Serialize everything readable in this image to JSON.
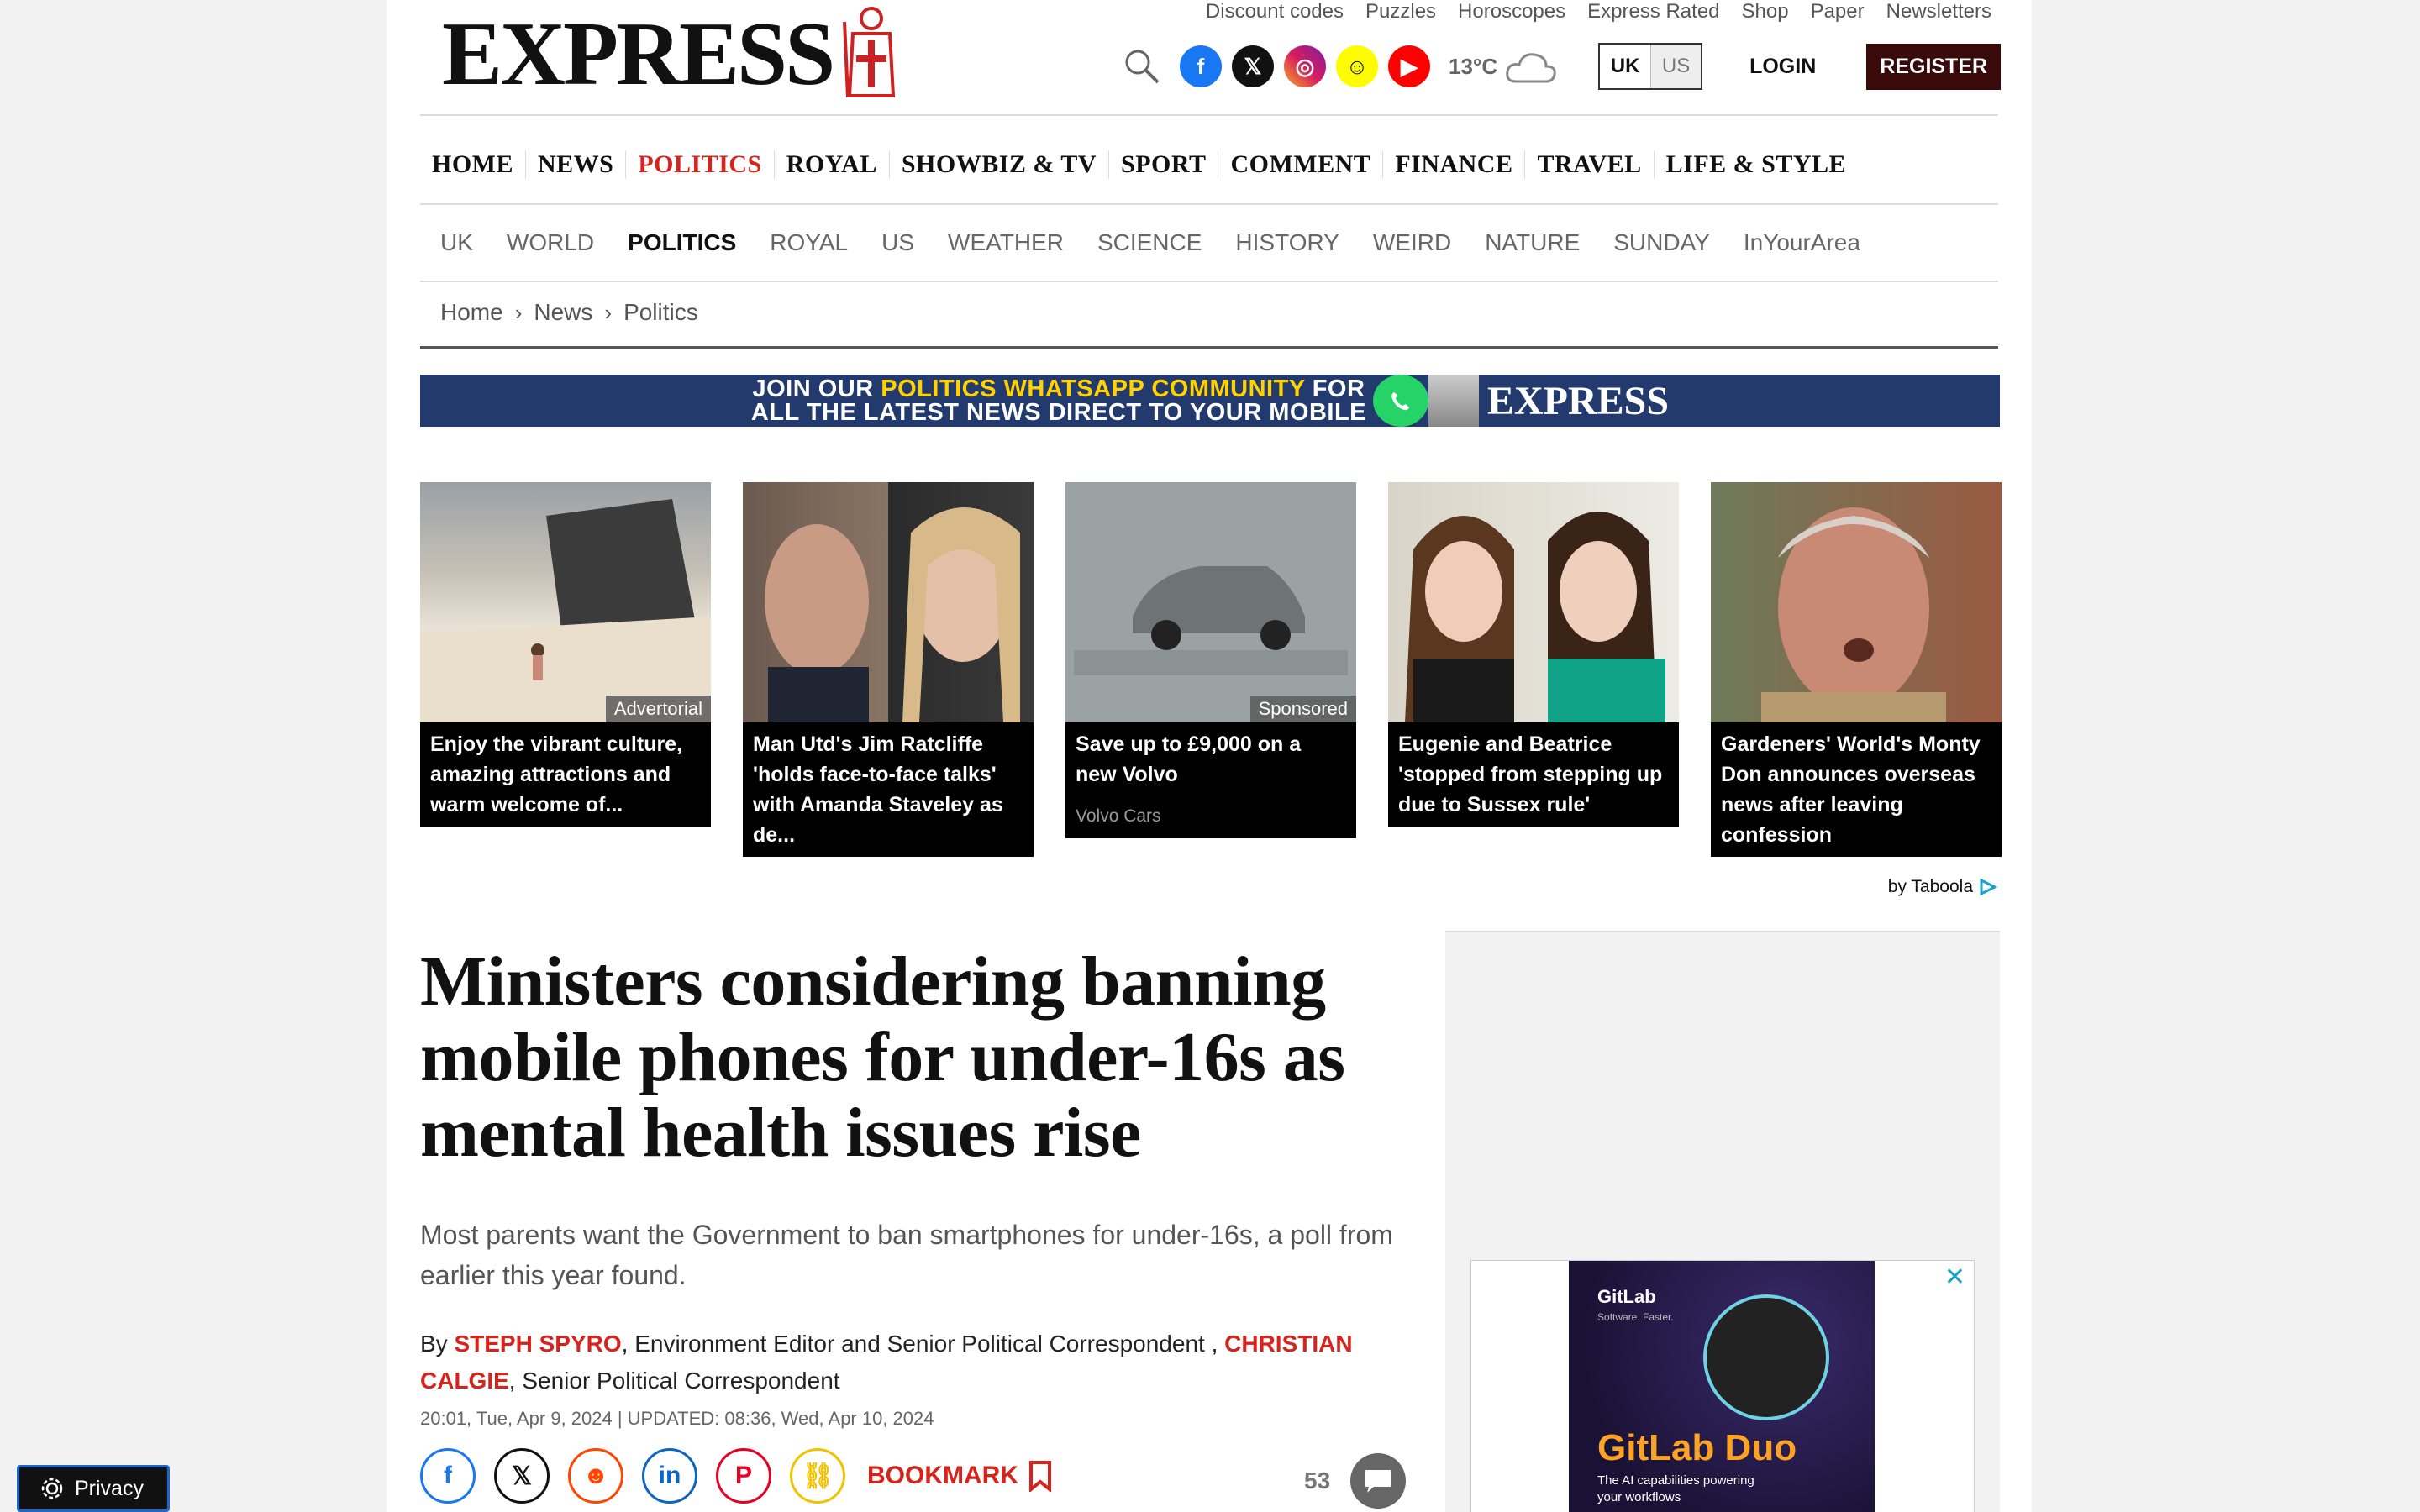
{
  "header": {
    "logo": "EXPRESS",
    "top_links": [
      "Discount codes",
      "Puzzles",
      "Horoscopes",
      "Express Rated",
      "Shop",
      "Paper",
      "Newsletters"
    ],
    "temperature": "13°C",
    "edition_uk": "UK",
    "edition_us": "US",
    "login": "LOGIN",
    "register": "REGISTER"
  },
  "main_nav": [
    "HOME",
    "NEWS",
    "POLITICS",
    "ROYAL",
    "SHOWBIZ & TV",
    "SPORT",
    "COMMENT",
    "FINANCE",
    "TRAVEL",
    "LIFE & STYLE"
  ],
  "sub_nav": [
    "UK",
    "WORLD",
    "POLITICS",
    "ROYAL",
    "US",
    "WEATHER",
    "SCIENCE",
    "HISTORY",
    "WEIRD",
    "NATURE",
    "SUNDAY",
    "InYourArea"
  ],
  "breadcrumb": [
    "Home",
    "News",
    "Politics"
  ],
  "banner": {
    "line1_a": "JOIN OUR ",
    "line1_hl": "POLITICS WHATSAPP COMMUNITY",
    "line1_b": " FOR",
    "line2": "ALL THE LATEST NEWS DIRECT TO YOUR MOBILE",
    "logo": "EXPRESS"
  },
  "cards": [
    {
      "caption": "Enjoy the vibrant culture, amazing attractions and warm welcome of...",
      "tag": "Advertorial",
      "source": ""
    },
    {
      "caption": "Man Utd's Jim Ratcliffe 'holds face-to-face talks' with Amanda Staveley as de...",
      "tag": "",
      "source": ""
    },
    {
      "caption": "Save up to £9,000 on a new Volvo",
      "tag": "Sponsored",
      "source": "Volvo Cars"
    },
    {
      "caption": "Eugenie and Beatrice 'stopped from stepping up due to Sussex rule'",
      "tag": "",
      "source": ""
    },
    {
      "caption": "Gardeners' World's Monty Don announces overseas news after leaving confession",
      "tag": "",
      "source": ""
    }
  ],
  "taboola": "by Taboola",
  "article": {
    "headline": "Ministers considering banning mobile phones for under-16s as mental health issues rise",
    "standfirst": "Most parents want the Government to ban smartphones for under-16s, a poll from earlier this year found.",
    "by": "By ",
    "author1": "STEPH SPYRO",
    "role1": ", Environment Editor and Senior Political Correspondent , ",
    "author2": "CHRISTIAN CALGIE",
    "role2": ", Senior Political Correspondent",
    "dates": "20:01, Tue, Apr 9, 2024 | UPDATED: 08:36, Wed, Apr 10, 2024",
    "bookmark": "BOOKMARK",
    "comments": "53"
  },
  "ad": {
    "brand": "GitLab",
    "tagline": "Software. Faster.",
    "product": "GitLab Duo",
    "sub": "The AI capabilities powering your workflows"
  },
  "privacy": "Privacy"
}
